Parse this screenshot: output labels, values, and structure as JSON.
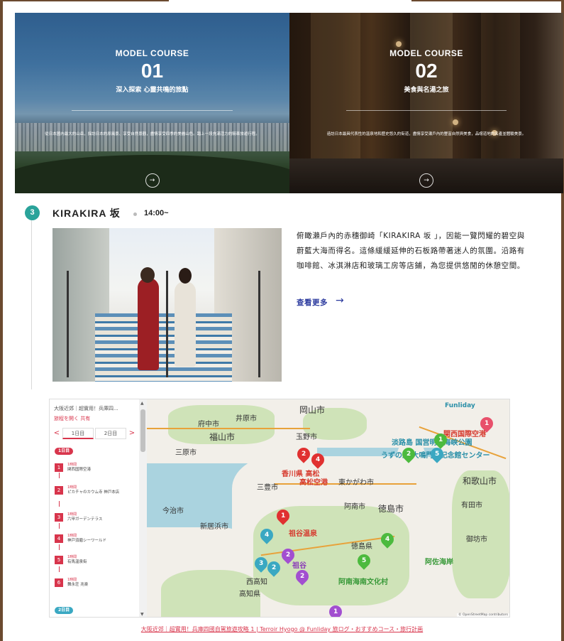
{
  "banners": [
    {
      "label": "MODEL COURSE",
      "num": "01",
      "subtitle": "深入探索 心靈共鳴的旅點",
      "desc": "從日本國內最大的山岳，探訪日本的原風景、享受自然景觀，盡情享受四季的美麗山色。踏上一段充滿活力的騎車旅遊行程。",
      "arrow": "→"
    },
    {
      "label": "MODEL COURSE",
      "num": "02",
      "subtitle": "美食與名湯之旅",
      "desc": "造訪日本最具代表性的溫泉地和歷史悠久的街道，盡情享受瀨戶內的豐富自然與美食，品嚐道地的名產並體驗美景。",
      "arrow": "→"
    }
  ],
  "stop": {
    "step": "3",
    "title": "KIRAKIRA 坂",
    "time": "14:00~",
    "description": "俯瞰瀨戶內的赤穗御崎「KIRAKIRA 坂 」，因能一覽閃耀的碧空與蔚藍大海而得名。這條緩緩延伸的石板路帶著迷人的氛圍。沿路有咖啡館、冰淇淋店和玻璃工房等店鋪，為您提供悠閒的休憩空間。",
    "more_label": "查看更多",
    "more_arrow": "→"
  },
  "map_sidebar": {
    "title": "大阪近郊｜超實用！兵庫四...",
    "actions": "旅程を開く  共有",
    "tab_prev": "<",
    "tab_next": ">",
    "tabs": [
      "1日目",
      "2日目"
    ],
    "day1_label": "1日目",
    "day2_label": "2日目",
    "items": [
      {
        "num": "1",
        "duration": "1時間",
        "name": "関西国際空港"
      },
      {
        "num": "2",
        "duration": "1時間",
        "name": "ピカチャのカウム寺 神戸本店"
      },
      {
        "num": "3",
        "duration": "1時間",
        "name": "六甲ガーデンテラス"
      },
      {
        "num": "4",
        "duration": "1時間",
        "name": "神戸須磨シーワールド"
      },
      {
        "num": "5",
        "duration": "1時間",
        "name": "有馬温泉街"
      },
      {
        "num": "6",
        "duration": "1時間",
        "name": "舞永荘 兆楽"
      }
    ]
  },
  "map_labels": {
    "okayama": "岡山市",
    "fuchu": "府中市",
    "fukuyama": "福山市",
    "ihara": "井原市",
    "sanagi": "三原市",
    "tamano": "玉野市",
    "imabari": "今治市",
    "niihama": "新居浜市",
    "tokushima": "徳島市",
    "anan": "阿南市",
    "wakayama": "和歌山市",
    "arida": "有田市",
    "gobo": "御坊市",
    "higashikagawa": "東かがわ市",
    "tokushima_pref": "徳島県",
    "mima": "三豊市",
    "kansai_airport": "関西国際空港",
    "takamatsu_airport": "高松空港",
    "kagawa_kotohira": "香川県 高松",
    "awaji": "淡路島 国営明石海峡公園",
    "awaji2": "うずの丘 大鳴門橋記念館センター",
    "iya": "祖谷温泉",
    "iya2": "祖谷",
    "shishikui": "阿佐海岸",
    "anan_kaiyo": "阿南海南文化村",
    "kochi": "高知県",
    "tonomo": "西高知",
    "funliday": "Funliday",
    "attribution": "© OpenStreetMap contributors"
  },
  "footer": {
    "link": "大阪近郊｜超實用！兵庫四國自駕旅遊攻略 1 | Terroir Hyogo @ Funliday 旅ログ・おすすめコース・旅行計画"
  },
  "colors": {
    "frame": "#6b4a2f",
    "accent_red": "#d8354c",
    "teal": "#2aa39a",
    "link_blue": "#2b3a9e",
    "water": "#aad3df"
  }
}
